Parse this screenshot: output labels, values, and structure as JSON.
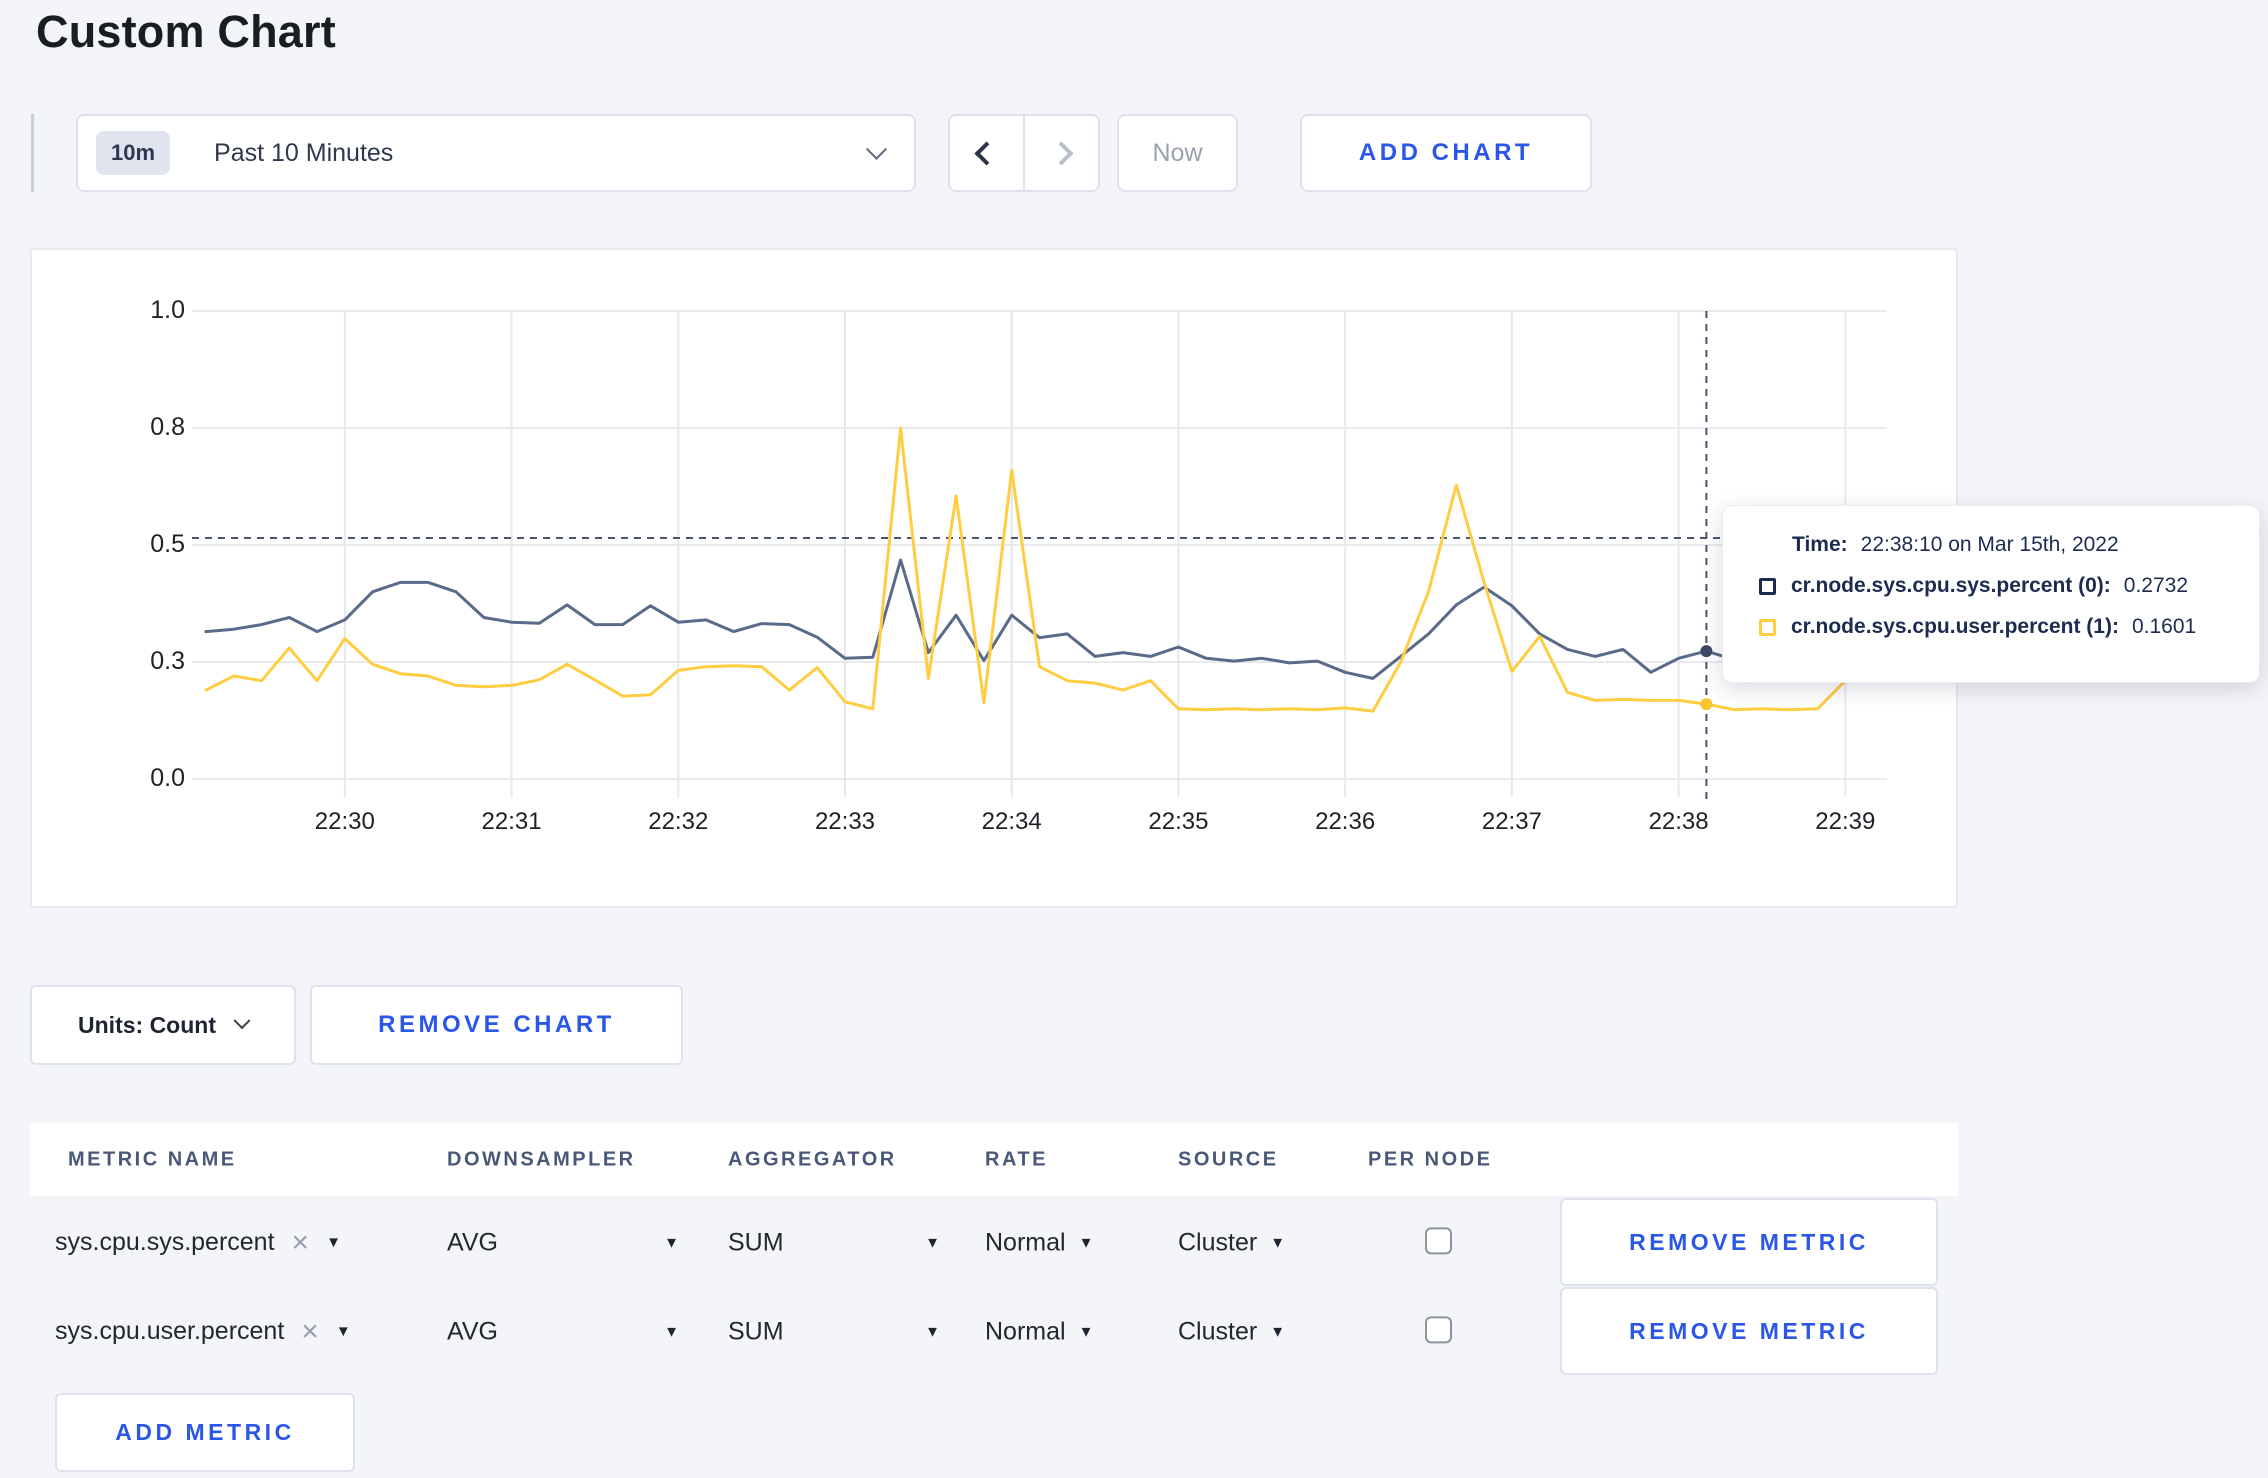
{
  "page": {
    "title": "Custom Chart"
  },
  "toolbar": {
    "time_badge": "10m",
    "time_label": "Past 10 Minutes",
    "now_label": "Now",
    "add_chart_label": "ADD CHART"
  },
  "chart_data": {
    "type": "line",
    "xlabel": "",
    "ylabel": "",
    "ylim": [
      0,
      1
    ],
    "grid": true,
    "x_tick_labels": [
      "22:30",
      "22:31",
      "22:32",
      "22:33",
      "22:34",
      "22:35",
      "22:36",
      "22:37",
      "22:38",
      "22:39"
    ],
    "y_tick_labels": [
      "1.0",
      "0.8",
      "0.5",
      "0.3",
      "0.0"
    ],
    "y_tick_values": [
      1,
      0.75,
      0.5,
      0.25,
      0
    ],
    "time_start": "22:29:05",
    "time_span_seconds": 610,
    "first_point_offset_seconds": 5,
    "point_interval_seconds": 10,
    "minute_tick_offset_seconds": 55,
    "series": [
      {
        "name": "cr.node.sys.cpu.sys.percent",
        "color": "#5a6a89",
        "dot_color": "#3e4a66",
        "values": [
          0.315,
          0.32,
          0.33,
          0.345,
          0.315,
          0.34,
          0.4,
          0.42,
          0.42,
          0.4,
          0.345,
          0.335,
          0.333,
          0.372,
          0.33,
          0.33,
          0.37,
          0.335,
          0.34,
          0.315,
          0.332,
          0.33,
          0.303,
          0.258,
          0.26,
          0.468,
          0.27,
          0.35,
          0.253,
          0.35,
          0.302,
          0.31,
          0.262,
          0.27,
          0.262,
          0.282,
          0.258,
          0.252,
          0.258,
          0.248,
          0.252,
          0.228,
          0.215,
          0.262,
          0.31,
          0.372,
          0.41,
          0.37,
          0.31,
          0.277,
          0.262,
          0.277,
          0.228,
          0.258,
          0.2732,
          0.255,
          0.298,
          0.31,
          0.305,
          0.296,
          0.3
        ]
      },
      {
        "name": "cr.node.sys.cpu.user.percent",
        "color": "#ffcd42",
        "dot_color": "#fbc42c",
        "values": [
          0.19,
          0.22,
          0.21,
          0.28,
          0.21,
          0.3,
          0.245,
          0.225,
          0.22,
          0.2,
          0.197,
          0.2,
          0.212,
          0.245,
          0.212,
          0.177,
          0.18,
          0.232,
          0.24,
          0.242,
          0.24,
          0.19,
          0.238,
          0.165,
          0.15,
          0.75,
          0.215,
          0.605,
          0.163,
          0.66,
          0.24,
          0.21,
          0.205,
          0.19,
          0.21,
          0.15,
          0.148,
          0.15,
          0.148,
          0.15,
          0.148,
          0.152,
          0.145,
          0.25,
          0.4,
          0.628,
          0.42,
          0.23,
          0.305,
          0.185,
          0.168,
          0.17,
          0.168,
          0.168,
          0.1601,
          0.148,
          0.15,
          0.148,
          0.15,
          0.21,
          0.285
        ]
      }
    ],
    "crosshair": {
      "time": "22:38:10",
      "offset_seconds": 545,
      "y_fraction": 0.515,
      "color": "#49556e",
      "point_values": [
        0.2732,
        0.1601
      ]
    }
  },
  "tooltip": {
    "time_label": "Time:",
    "time_value": "22:38:10 on Mar 15th, 2022",
    "rows": [
      {
        "label": "cr.node.sys.cpu.sys.percent (0):",
        "value": "0.2732",
        "color": "#1c2c50"
      },
      {
        "label": "cr.node.sys.cpu.user.percent (1):",
        "value": "0.1601",
        "color": "#ffcd42"
      }
    ]
  },
  "chart_controls": {
    "units_label": "Units: Count",
    "remove_chart_label": "REMOVE CHART"
  },
  "metrics_table": {
    "headers": [
      "METRIC NAME",
      "DOWNSAMPLER",
      "AGGREGATOR",
      "RATE",
      "SOURCE",
      "PER NODE"
    ],
    "rows": [
      {
        "metric": "sys.cpu.sys.percent",
        "downsampler": "AVG",
        "aggregator": "SUM",
        "rate": "Normal",
        "source": "Cluster",
        "per_node_checked": false,
        "remove_label": "REMOVE METRIC"
      },
      {
        "metric": "sys.cpu.user.percent",
        "downsampler": "AVG",
        "aggregator": "SUM",
        "rate": "Normal",
        "source": "Cluster",
        "per_node_checked": false,
        "remove_label": "REMOVE METRIC"
      }
    ],
    "add_metric_label": "ADD METRIC"
  }
}
